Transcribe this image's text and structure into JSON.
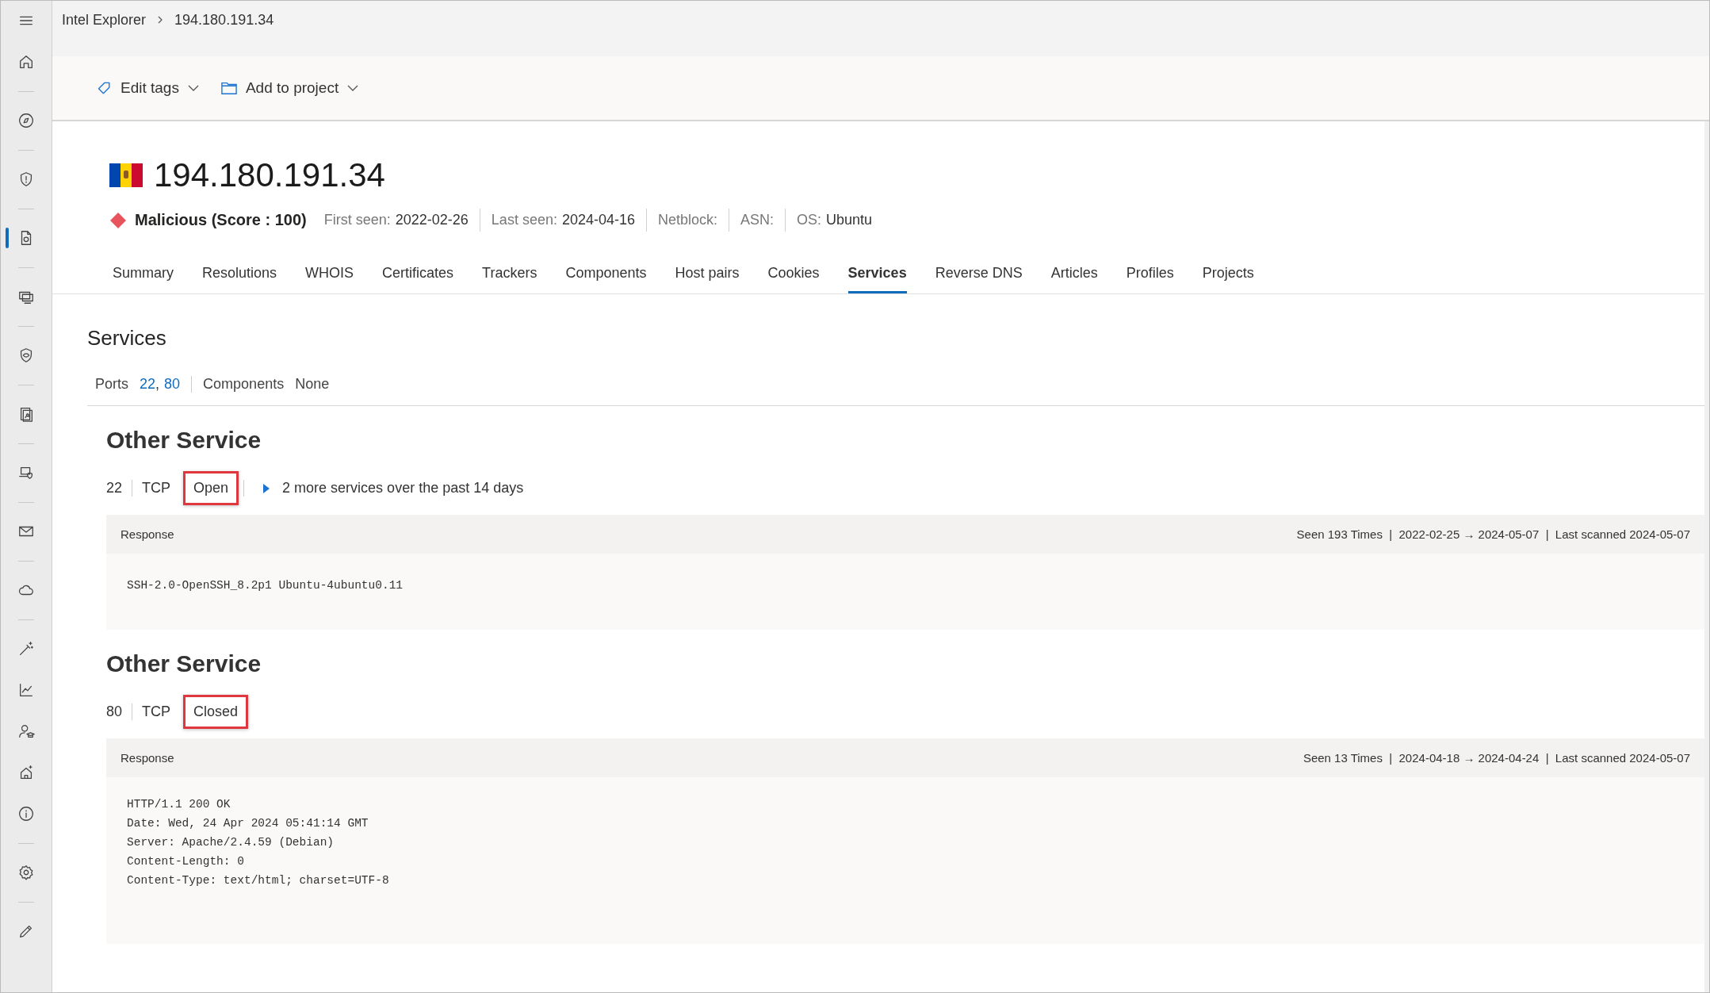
{
  "sidebar": {
    "groups": [
      [
        {
          "kind": "menu",
          "selected": false
        },
        {
          "kind": "home",
          "selected": false
        }
      ],
      [
        {
          "kind": "compass",
          "selected": false
        }
      ],
      [
        {
          "kind": "shield-alert",
          "selected": false
        }
      ],
      [
        {
          "kind": "document",
          "selected": true
        }
      ],
      [
        {
          "kind": "monitors",
          "selected": false
        }
      ],
      [
        {
          "kind": "shield-eye",
          "selected": false
        }
      ],
      [
        {
          "kind": "contact",
          "selected": false
        }
      ],
      [
        {
          "kind": "laptop-shield",
          "selected": false
        }
      ],
      [
        {
          "kind": "mail",
          "selected": false
        }
      ],
      [
        {
          "kind": "cloud",
          "selected": false
        }
      ],
      [
        {
          "kind": "wand",
          "selected": false
        },
        {
          "kind": "chart",
          "selected": false
        },
        {
          "kind": "person-cap",
          "selected": false
        },
        {
          "kind": "house-sparkle",
          "selected": false
        },
        {
          "kind": "info",
          "selected": false
        }
      ],
      [
        {
          "kind": "settings",
          "selected": false
        }
      ],
      [
        {
          "kind": "pencil",
          "selected": false
        }
      ]
    ]
  },
  "breadcrumb": [
    "Intel Explorer",
    "194.180.191.34"
  ],
  "toolbar": [
    {
      "kind": "tag",
      "label": "Edit tags"
    },
    {
      "kind": "folder",
      "label": "Add to project"
    }
  ],
  "header": {
    "title": "194.180.191.34",
    "verdict": {
      "text": "Malicious (Score : 100)",
      "color": "#e8545c"
    },
    "meta": [
      {
        "label": "First seen:",
        "value": "2022-02-26"
      },
      {
        "label": "Last seen:",
        "value": "2024-04-16"
      },
      {
        "label": "Netblock:"
      },
      {
        "label": "ASN:"
      },
      {
        "label": "OS:",
        "value": "Ubuntu"
      }
    ]
  },
  "tabs": [
    {
      "label": "Summary",
      "selected": false
    },
    {
      "label": "Resolutions",
      "selected": false
    },
    {
      "label": "WHOIS",
      "selected": false
    },
    {
      "label": "Certificates",
      "selected": false
    },
    {
      "label": "Trackers",
      "selected": false
    },
    {
      "label": "Components",
      "selected": false
    },
    {
      "label": "Host pairs",
      "selected": false
    },
    {
      "label": "Cookies",
      "selected": false
    },
    {
      "label": "Services",
      "selected": true
    },
    {
      "label": "Reverse DNS",
      "selected": false
    },
    {
      "label": "Articles",
      "selected": false
    },
    {
      "label": "Profiles",
      "selected": false
    },
    {
      "label": "Projects",
      "selected": false
    }
  ],
  "services": {
    "title": "Services",
    "ports_label": "Ports",
    "ports": [
      "22",
      "80"
    ],
    "ports_separator": ",",
    "components_label": "Components",
    "components_value": "None",
    "items": [
      {
        "title": "Other Service",
        "port": "22",
        "protocol": "TCP",
        "status": "Open",
        "highlighted": true,
        "more": {
          "text": "2 more services over the past 14 days",
          "expanded": false
        },
        "response_label": "Response",
        "stats": "Seen 193 Times  |  2022-02-25 → 2024-05-07  |  Last scanned 2024-05-07",
        "response": [
          "SSH-2.0-OpenSSH_8.2p1 Ubuntu-4ubuntu0.11"
        ]
      },
      {
        "title": "Other Service",
        "port": "80",
        "protocol": "TCP",
        "status": "Closed",
        "highlighted": true,
        "response_label": "Response",
        "stats": "Seen 13 Times  |  2024-04-18 → 2024-04-24  |  Last scanned 2024-05-07",
        "response": [
          "HTTP/1.1 200 OK",
          "Date: Wed, 24 Apr 2024 05:41:14 GMT",
          "Server: Apache/2.4.59 (Debian)",
          "Content-Length: 0",
          "Content-Type: text/html; charset=UTF-8"
        ]
      }
    ]
  }
}
